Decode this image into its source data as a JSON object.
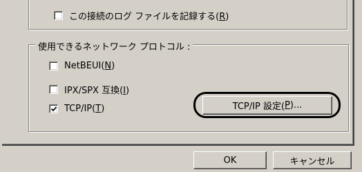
{
  "logging": {
    "label": "この接続のログ ファイルを記録する(",
    "mnemonic": "R",
    "suffix": ")",
    "checked": false
  },
  "protocols": {
    "legend": "使用できるネットワーク プロトコル :",
    "items": [
      {
        "label": "NetBEUI(",
        "mnemonic": "N",
        "suffix": ")",
        "checked": false
      },
      {
        "label": "IPX/SPX 互換(",
        "mnemonic": "I",
        "suffix": ")",
        "checked": false
      },
      {
        "label": "TCP/IP(",
        "mnemonic": "T",
        "suffix": ")",
        "checked": true
      }
    ],
    "settings_button": {
      "label": "TCP/IP 設定(",
      "mnemonic": "P",
      "suffix": ")..."
    }
  },
  "footer": {
    "ok_label": "OK",
    "cancel_label": "キャンセル"
  }
}
